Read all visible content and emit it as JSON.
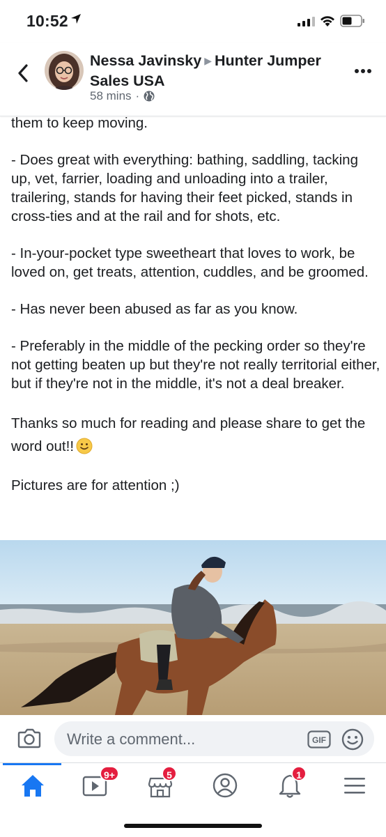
{
  "status_bar": {
    "time": "10:52"
  },
  "header": {
    "author": "Nessa Javinsky",
    "group": "Hunter Jumper Sales USA",
    "time_ago": "58 mins",
    "privacy_icon": "globe-icon"
  },
  "post": {
    "paragraphs": [
      "them to keep moving.",
      "- Does great with everything: bathing, saddling, tacking up, vet, farrier, loading and unloading into a trailer, trailering, stands for having their feet picked, stands in cross-ties and at the rail and for shots, etc.",
      "- In-your-pocket type sweetheart that loves to work, be loved on, get treats, attention, cuddles, and be groomed.",
      "- Has never been abused as far as you know.",
      "- Preferably in the middle of the pecking order so they're not getting beaten up but they're not really territorial either, but if they're not in the middle, it's not a deal breaker.",
      "Thanks so much for reading and please share to get the word out!!",
      "Pictures are for attention ;)"
    ],
    "photo_icon": "horse-rider-beach-photo"
  },
  "comment_bar": {
    "placeholder": "Write a comment...",
    "gif_label": "GIF"
  },
  "tabbar": {
    "watch_badge": "9+",
    "marketplace_badge": "5",
    "notifications_badge": "1"
  },
  "colors": {
    "accent": "#1877f2",
    "badge": "#e41e3f",
    "text": "#1c1e21",
    "secondary": "#606770"
  }
}
